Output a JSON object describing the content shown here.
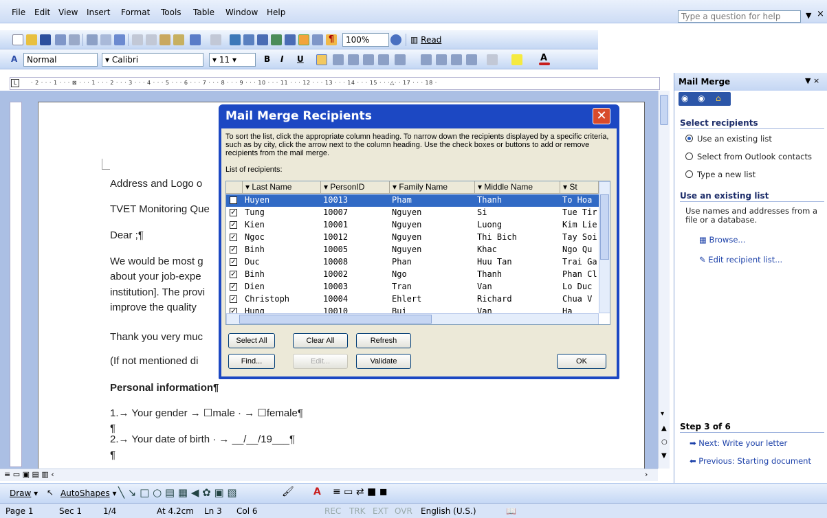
{
  "menu": [
    "File",
    "Edit",
    "View",
    "Insert",
    "Format",
    "Tools",
    "Table",
    "Window",
    "Help"
  ],
  "help_placeholder": "Type a question for help",
  "toolbar": {
    "zoom": "100%",
    "read": "Read",
    "style": "Normal",
    "font": "Calibri",
    "size": "11"
  },
  "ruler": "· 2 · · · 1 · · · ⊠ · · · 1 · · · 2 · · · 3 · · · 4 · · · 5 · · · 6 · · · 7 · · · 8 · · · 9 · · · 10 · · · 11 · · · 12 · · · 13 · · · 14 · · · 15 · · ·△· · 17 · · · 18 ·",
  "document": {
    "line1": "Address and Logo o",
    "line2": "TVET Monitoring Que",
    "line3": "Dear ;¶",
    "line4": "We would be most g",
    "line5": "about your job-expe",
    "line6": "institution]. The provi",
    "line7": "improve the quality",
    "line8": "Thank you very muc",
    "line9": "(If not mentioned di",
    "line10": "Personal information¶",
    "line11": "1.→ Your gender  →  ☐male ·  →  ☐female¶",
    "line12": "¶",
    "line13": "2.→ Your date of birth ·  →  __/__/19___¶",
    "line14": "¶"
  },
  "dialog": {
    "title": "Mail Merge Recipients",
    "instructions": "To sort the list, click the appropriate column heading.  To narrow down the recipients displayed by a specific criteria, such as by city, click the arrow next to the column heading.  Use the check boxes or buttons to add or remove recipients from the mail merge.",
    "list_label": "List of recipients:",
    "columns": [
      "Last Name",
      "PersonID",
      "Family Name",
      "Middle Name",
      "St"
    ],
    "rows": [
      [
        "Huyen",
        "10013",
        "Pham",
        "Thanh",
        "To Hoa"
      ],
      [
        "Tung",
        "10007",
        "Nguyen",
        "Si",
        "Tue Tir"
      ],
      [
        "Kien",
        "10001",
        "Nguyen",
        "Luong",
        "Kim Lie"
      ],
      [
        "Ngoc",
        "10012",
        "Nguyen",
        "Thi Bich",
        "Tay Soi"
      ],
      [
        "Binh",
        "10005",
        "Nguyen",
        "Khac",
        "Ngo Qu"
      ],
      [
        "Duc",
        "10008",
        "Phan",
        "Huu Tan",
        "Trai Ga"
      ],
      [
        "Binh",
        "10002",
        "Ngo",
        "Thanh",
        "Phan Cl"
      ],
      [
        "Dien",
        "10003",
        "Tran",
        "Van",
        "Lo Duc"
      ],
      [
        "Christoph",
        "10004",
        "Ehlert",
        "Richard",
        "Chua V"
      ],
      [
        "Hung",
        "10010",
        "Bui",
        "Van",
        "Ha"
      ]
    ],
    "buttons": {
      "select_all": "Select All",
      "clear_all": "Clear All",
      "refresh": "Refresh",
      "find": "Find...",
      "edit": "Edit...",
      "validate": "Validate",
      "ok": "OK"
    }
  },
  "pane": {
    "title": "Mail Merge",
    "section1": "Select recipients",
    "opt1": "Use an existing list",
    "opt2": "Select from Outlook contacts",
    "opt3": "Type a new list",
    "section2": "Use an existing list",
    "desc": "Use names and addresses from a file or a database.",
    "browse": "Browse...",
    "edit_list": "Edit recipient list...",
    "step": "Step 3 of 6",
    "next": "Next: Write your letter",
    "prev": "Previous: Starting document"
  },
  "drawbar": {
    "draw": "Draw",
    "autoshapes": "AutoShapes"
  },
  "status": {
    "page": "Page 1",
    "sec": "Sec 1",
    "pages": "1/4",
    "at": "At 4.2cm",
    "ln": "Ln 3",
    "col": "Col 6",
    "rec": "REC",
    "trk": "TRK",
    "ext": "EXT",
    "ovr": "OVR",
    "lang": "English (U.S.)"
  }
}
